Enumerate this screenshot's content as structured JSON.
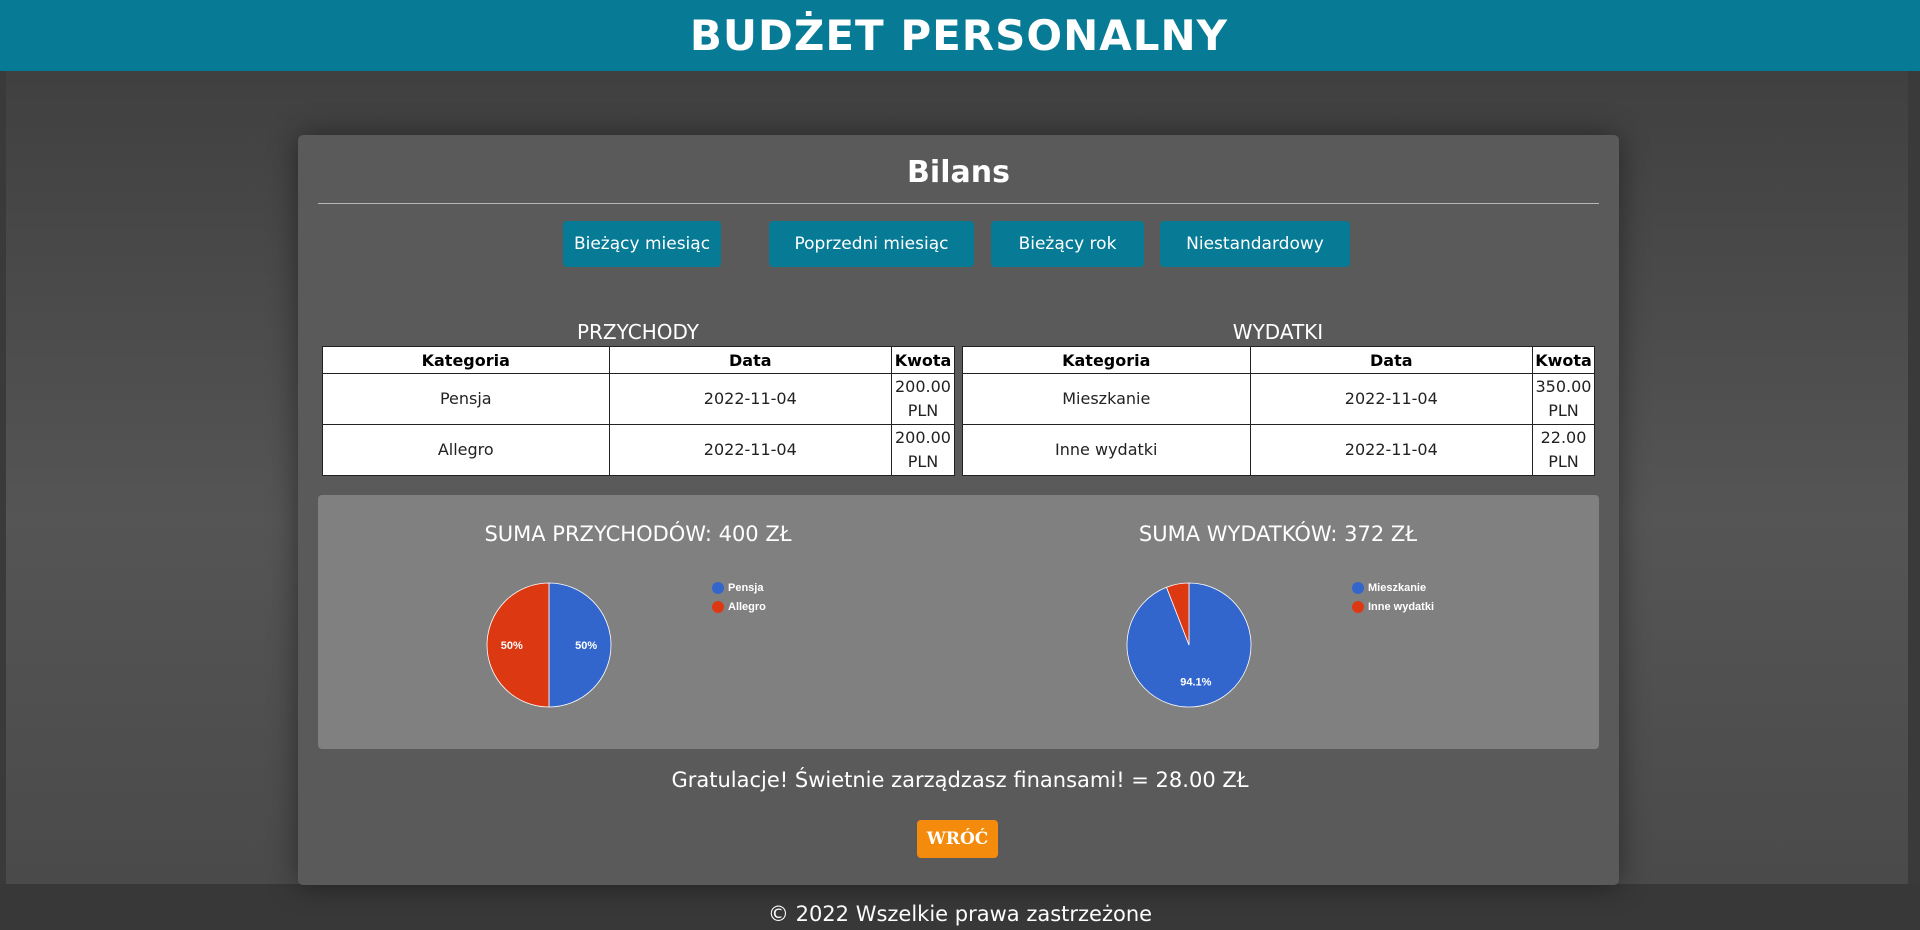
{
  "header": {
    "title": "BUDŻET PERSONALNY"
  },
  "card": {
    "title": "Bilans"
  },
  "periods": [
    "Bieżący miesiąc",
    "Poprzedni miesiąc",
    "Bieżący rok",
    "Niestandardowy"
  ],
  "income": {
    "title": "PRZYCHODY",
    "columns": [
      "Kategoria",
      "Data",
      "Kwota"
    ],
    "rows": [
      {
        "category": "Pensja",
        "date": "2022-11-04",
        "amount": "200.00",
        "currency": "PLN"
      },
      {
        "category": "Allegro",
        "date": "2022-11-04",
        "amount": "200.00",
        "currency": "PLN"
      }
    ]
  },
  "expenses": {
    "title": "WYDATKI",
    "columns": [
      "Kategoria",
      "Data",
      "Kwota"
    ],
    "rows": [
      {
        "category": "Mieszkanie",
        "date": "2022-11-04",
        "amount": "350.00",
        "currency": "PLN"
      },
      {
        "category": "Inne wydatki",
        "date": "2022-11-04",
        "amount": "22.00",
        "currency": "PLN"
      }
    ]
  },
  "income_chart": {
    "sum_label": "SUMA PRZYCHODÓW: 400 ZŁ",
    "slice_labels": [
      "50%",
      "50%"
    ],
    "legend": [
      "Pensja",
      "Allegro"
    ]
  },
  "expense_chart": {
    "sum_label": "SUMA WYDATKÓW: 372 ZŁ",
    "slice_labels": [
      "94.1%"
    ],
    "legend": [
      "Mieszkanie",
      "Inne wydatki"
    ]
  },
  "chart_data": [
    {
      "type": "pie",
      "categories": [
        "Pensja",
        "Allegro"
      ],
      "values": [
        200,
        200
      ],
      "colors": [
        "#3366cc",
        "#dc3912"
      ]
    },
    {
      "type": "pie",
      "categories": [
        "Mieszkanie",
        "Inne wydatki"
      ],
      "values": [
        350,
        22
      ],
      "colors": [
        "#3366cc",
        "#dc3912"
      ]
    }
  ],
  "balance": {
    "message": "Gratulacje! Świetnie zarządzasz finansami! = 28.00 ZŁ"
  },
  "back_button": {
    "label": "WRÓĆ"
  },
  "footer": {
    "text": "© 2022 Wszelkie prawa zastrzeżone"
  }
}
